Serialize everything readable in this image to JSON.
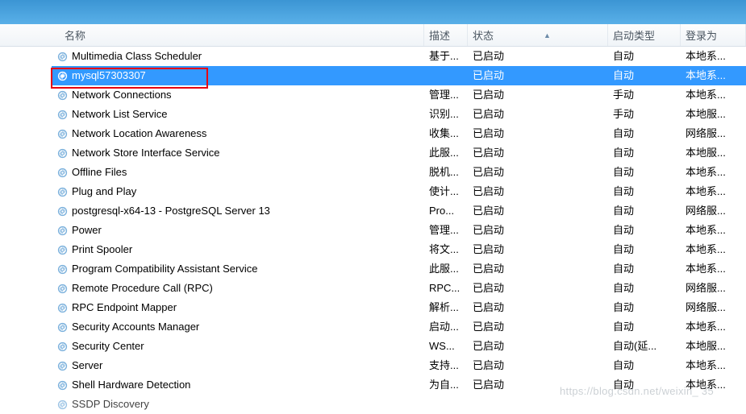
{
  "columns": {
    "name": "名称",
    "description": "描述",
    "status": "状态",
    "startup": "启动类型",
    "logon": "登录为"
  },
  "services": [
    {
      "name": "Multimedia Class Scheduler",
      "desc": "基于...",
      "status": "已启动",
      "startup": "自动",
      "logon": "本地系..."
    },
    {
      "name": "mysql57303307",
      "desc": "",
      "status": "已启动",
      "startup": "自动",
      "logon": "本地系...",
      "selected": true
    },
    {
      "name": "Network Connections",
      "desc": "管理...",
      "status": "已启动",
      "startup": "手动",
      "logon": "本地系..."
    },
    {
      "name": "Network List Service",
      "desc": "识别...",
      "status": "已启动",
      "startup": "手动",
      "logon": "本地服..."
    },
    {
      "name": "Network Location Awareness",
      "desc": "收集...",
      "status": "已启动",
      "startup": "自动",
      "logon": "网络服..."
    },
    {
      "name": "Network Store Interface Service",
      "desc": "此服...",
      "status": "已启动",
      "startup": "自动",
      "logon": "本地服..."
    },
    {
      "name": "Offline Files",
      "desc": "脱机...",
      "status": "已启动",
      "startup": "自动",
      "logon": "本地系..."
    },
    {
      "name": "Plug and Play",
      "desc": "使计...",
      "status": "已启动",
      "startup": "自动",
      "logon": "本地系..."
    },
    {
      "name": "postgresql-x64-13 - PostgreSQL Server 13",
      "desc": "Pro...",
      "status": "已启动",
      "startup": "自动",
      "logon": "网络服..."
    },
    {
      "name": "Power",
      "desc": "管理...",
      "status": "已启动",
      "startup": "自动",
      "logon": "本地系..."
    },
    {
      "name": "Print Spooler",
      "desc": "将文...",
      "status": "已启动",
      "startup": "自动",
      "logon": "本地系..."
    },
    {
      "name": "Program Compatibility Assistant Service",
      "desc": "此服...",
      "status": "已启动",
      "startup": "自动",
      "logon": "本地系..."
    },
    {
      "name": "Remote Procedure Call (RPC)",
      "desc": "RPC...",
      "status": "已启动",
      "startup": "自动",
      "logon": "网络服..."
    },
    {
      "name": "RPC Endpoint Mapper",
      "desc": "解析...",
      "status": "已启动",
      "startup": "自动",
      "logon": "网络服..."
    },
    {
      "name": "Security Accounts Manager",
      "desc": "启动...",
      "status": "已启动",
      "startup": "自动",
      "logon": "本地系..."
    },
    {
      "name": "Security Center",
      "desc": "WS...",
      "status": "已启动",
      "startup": "自动(延...",
      "logon": "本地服..."
    },
    {
      "name": "Server",
      "desc": "支持...",
      "status": "已启动",
      "startup": "自动",
      "logon": "本地系..."
    },
    {
      "name": "Shell Hardware Detection",
      "desc": "为自...",
      "status": "已启动",
      "startup": "自动",
      "logon": "本地系..."
    },
    {
      "name": "SSDP Discovery",
      "desc": "",
      "status": "",
      "startup": "",
      "logon": "",
      "partial": true
    }
  ],
  "watermark": "https://blog.csdn.net/weixin_         35"
}
